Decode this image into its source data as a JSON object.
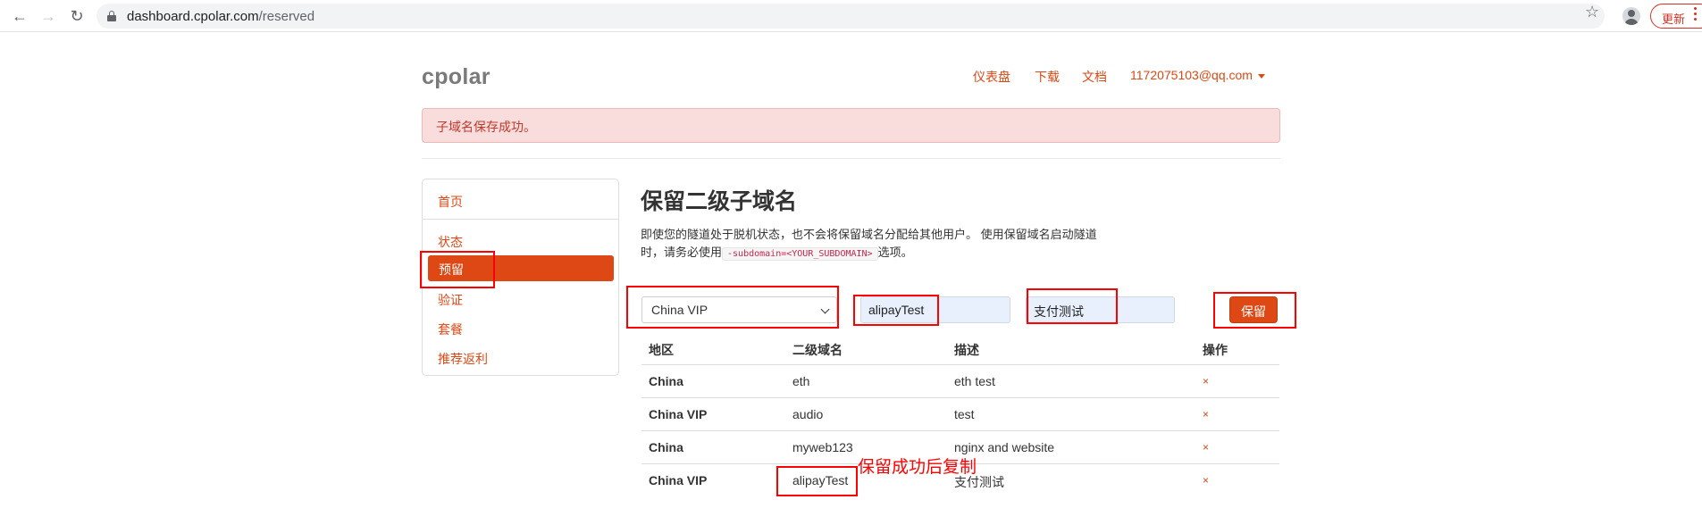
{
  "browser": {
    "url_host": "dashboard.cpolar.com",
    "url_path": "/reserved",
    "update_label": "更新"
  },
  "brand": "cpolar",
  "topnav": {
    "dashboard": "仪表盘",
    "download": "下载",
    "docs": "文档",
    "account": "1172075103@qq.com"
  },
  "alert": "子域名保存成功。",
  "sidebar": {
    "items": [
      {
        "label": "首页"
      },
      {
        "label": "状态"
      },
      {
        "label": "预留"
      },
      {
        "label": "验证"
      },
      {
        "label": "套餐"
      },
      {
        "label": "推荐返利"
      }
    ]
  },
  "main": {
    "title": "保留二级子域名",
    "desc_line1": "即使您的隧道处于脱机状态，也不会将保留域名分配给其他用户。 使用保留域名启动隧道",
    "desc_line2_pre": "时，请务必使用",
    "desc_code": "-subdomain=<YOUR_SUBDOMAIN>",
    "desc_line2_post": "选项。"
  },
  "form": {
    "region": "China VIP",
    "subdomain": "alipayTest",
    "description": "支付测试",
    "save_label": "保留"
  },
  "table": {
    "headers": [
      "地区",
      "二级域名",
      "描述",
      "操作"
    ],
    "rows": [
      {
        "region": "China",
        "subdomain": "eth",
        "description": "eth test",
        "action": "×"
      },
      {
        "region": "China VIP",
        "subdomain": "audio",
        "description": "test",
        "action": "×"
      },
      {
        "region": "China",
        "subdomain": "myweb123",
        "description": "nginx and website",
        "action": "×"
      },
      {
        "region": "China VIP",
        "subdomain": "alipayTest",
        "description": "支付测试",
        "action": "×"
      }
    ]
  },
  "annotation": "保留成功后复制",
  "colors": {
    "accent": "#dd4814",
    "alert_bg": "#f9dcdc",
    "annotation": "#ff0000"
  }
}
